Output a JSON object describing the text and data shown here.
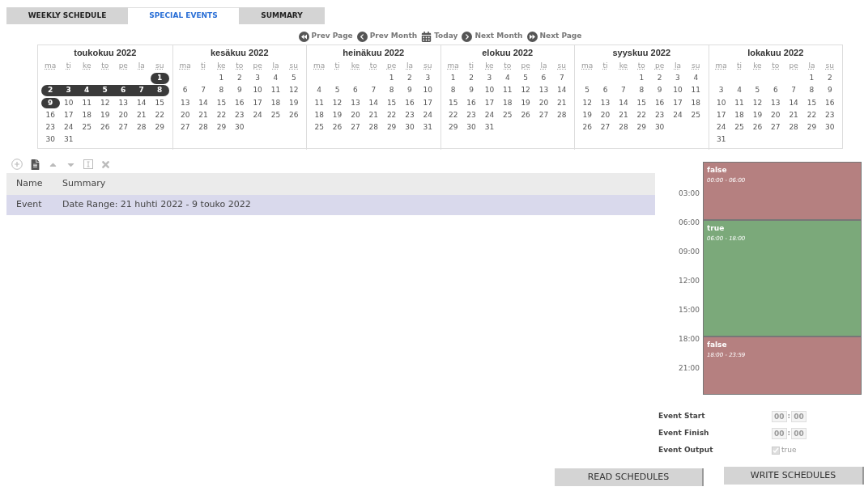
{
  "tabs": [
    {
      "label": "WEEKLY SCHEDULE",
      "selected": false
    },
    {
      "label": "SPECIAL EVENTS",
      "selected": true
    },
    {
      "label": "SUMMARY",
      "selected": false
    }
  ],
  "nav": [
    {
      "kind": "rewind",
      "label": "Prev Page"
    },
    {
      "kind": "back",
      "label": "Prev Month"
    },
    {
      "kind": "calendar",
      "label": "Today"
    },
    {
      "kind": "forward",
      "label": "Next Month"
    },
    {
      "kind": "fastforward",
      "label": "Next Page"
    }
  ],
  "months": [
    {
      "title": "toukokuu  2022",
      "weekdays": [
        "ma",
        "ti",
        "ke",
        "to",
        "pe",
        "la",
        "su"
      ],
      "weeks": [
        {
          "kind": "end",
          "days": [
            {
              "day": "1",
              "selected": true
            }
          ]
        },
        {
          "kind": "full",
          "days": [
            {
              "day": "2",
              "selected": true
            },
            {
              "day": "3",
              "selected": true
            },
            {
              "day": "4",
              "selected": true
            },
            {
              "day": "5",
              "selected": true
            },
            {
              "day": "6",
              "selected": true
            },
            {
              "day": "7",
              "selected": true
            },
            {
              "day": "8",
              "selected": true
            }
          ]
        },
        {
          "kind": "full",
          "days": [
            {
              "day": "9",
              "selected": true
            },
            {
              "day": "10",
              "selected": false
            },
            {
              "day": "11",
              "selected": false
            },
            {
              "day": "12",
              "selected": false
            },
            {
              "day": "13",
              "selected": false
            },
            {
              "day": "14",
              "selected": false
            },
            {
              "day": "15",
              "selected": false
            }
          ]
        },
        {
          "kind": "full",
          "days": [
            {
              "day": "16",
              "selected": false
            },
            {
              "day": "17",
              "selected": false
            },
            {
              "day": "18",
              "selected": false
            },
            {
              "day": "19",
              "selected": false
            },
            {
              "day": "20",
              "selected": false
            },
            {
              "day": "21",
              "selected": false
            },
            {
              "day": "22",
              "selected": false
            }
          ]
        },
        {
          "kind": "full",
          "days": [
            {
              "day": "23",
              "selected": false
            },
            {
              "day": "24",
              "selected": false
            },
            {
              "day": "25",
              "selected": false
            },
            {
              "day": "26",
              "selected": false
            },
            {
              "day": "27",
              "selected": false
            },
            {
              "day": "28",
              "selected": false
            },
            {
              "day": "29",
              "selected": false
            }
          ]
        },
        {
          "kind": "start",
          "days": [
            {
              "day": "30",
              "selected": false
            },
            {
              "day": "31",
              "selected": false
            }
          ]
        }
      ]
    },
    {
      "title": "kesäkuu  2022",
      "weekdays": [
        "ma",
        "ti",
        "ke",
        "to",
        "pe",
        "la",
        "su"
      ],
      "weeks": [
        {
          "kind": "end",
          "days": [
            "1",
            "2",
            "3",
            "4",
            "5"
          ]
        },
        {
          "kind": "full",
          "days": [
            "6",
            "7",
            "8",
            "9",
            "10",
            "11",
            "12"
          ]
        },
        {
          "kind": "full",
          "days": [
            "13",
            "14",
            "15",
            "16",
            "17",
            "18",
            "19"
          ]
        },
        {
          "kind": "full",
          "days": [
            "20",
            "21",
            "22",
            "23",
            "24",
            "25",
            "26"
          ]
        },
        {
          "kind": "start",
          "days": [
            "27",
            "28",
            "29",
            "30"
          ]
        }
      ]
    },
    {
      "title": "heinäkuu  2022",
      "weekdays": [
        "ma",
        "ti",
        "ke",
        "to",
        "pe",
        "la",
        "su"
      ],
      "weeks": [
        {
          "kind": "end",
          "days": [
            "1",
            "2",
            "3"
          ]
        },
        {
          "kind": "full",
          "days": [
            "4",
            "5",
            "6",
            "7",
            "8",
            "9",
            "10"
          ]
        },
        {
          "kind": "full",
          "days": [
            "11",
            "12",
            "13",
            "14",
            "15",
            "16",
            "17"
          ]
        },
        {
          "kind": "full",
          "days": [
            "18",
            "19",
            "20",
            "21",
            "22",
            "23",
            "24"
          ]
        },
        {
          "kind": "full",
          "days": [
            "25",
            "26",
            "27",
            "28",
            "29",
            "30",
            "31"
          ]
        }
      ]
    },
    {
      "title": "elokuu  2022",
      "weekdays": [
        "ma",
        "ti",
        "ke",
        "to",
        "pe",
        "la",
        "su"
      ],
      "weeks": [
        {
          "kind": "full",
          "days": [
            "1",
            "2",
            "3",
            "4",
            "5",
            "6",
            "7"
          ]
        },
        {
          "kind": "full",
          "days": [
            "8",
            "9",
            "10",
            "11",
            "12",
            "13",
            "14"
          ]
        },
        {
          "kind": "full",
          "days": [
            "15",
            "16",
            "17",
            "18",
            "19",
            "20",
            "21"
          ]
        },
        {
          "kind": "full",
          "days": [
            "22",
            "23",
            "24",
            "25",
            "26",
            "27",
            "28"
          ]
        },
        {
          "kind": "start",
          "days": [
            "29",
            "30",
            "31"
          ]
        }
      ]
    },
    {
      "title": "syyskuu  2022",
      "weekdays": [
        "ma",
        "ti",
        "ke",
        "to",
        "pe",
        "la",
        "su"
      ],
      "weeks": [
        {
          "kind": "end",
          "days": [
            "1",
            "2",
            "3",
            "4"
          ]
        },
        {
          "kind": "full",
          "days": [
            "5",
            "6",
            "7",
            "8",
            "9",
            "10",
            "11"
          ]
        },
        {
          "kind": "full",
          "days": [
            "12",
            "13",
            "14",
            "15",
            "16",
            "17",
            "18"
          ]
        },
        {
          "kind": "full",
          "days": [
            "19",
            "20",
            "21",
            "22",
            "23",
            "24",
            "25"
          ]
        },
        {
          "kind": "start",
          "days": [
            "26",
            "27",
            "28",
            "29",
            "30"
          ]
        }
      ]
    },
    {
      "title": "lokakuu  2022",
      "weekdays": [
        "ma",
        "ti",
        "ke",
        "to",
        "pe",
        "la",
        "su"
      ],
      "weeks": [
        {
          "kind": "end",
          "days": [
            "1",
            "2"
          ]
        },
        {
          "kind": "full",
          "days": [
            "3",
            "4",
            "5",
            "6",
            "7",
            "8",
            "9"
          ]
        },
        {
          "kind": "full",
          "days": [
            "10",
            "11",
            "12",
            "13",
            "14",
            "15",
            "16"
          ]
        },
        {
          "kind": "full",
          "days": [
            "17",
            "18",
            "19",
            "20",
            "21",
            "22",
            "23"
          ]
        },
        {
          "kind": "full",
          "days": [
            "24",
            "25",
            "26",
            "27",
            "28",
            "29",
            "30"
          ]
        },
        {
          "kind": "start",
          "days": [
            "31"
          ]
        }
      ]
    }
  ],
  "toolbar": [
    {
      "kind": "add",
      "disabled": true
    },
    {
      "kind": "document",
      "disabled": false
    },
    {
      "kind": "up",
      "disabled": true
    },
    {
      "kind": "down",
      "disabled": true
    },
    {
      "kind": "rename",
      "disabled": true
    },
    {
      "kind": "delete",
      "disabled": true
    }
  ],
  "table": {
    "columns": [
      "Name",
      "Summary"
    ],
    "rows": [
      {
        "cells": [
          "Event",
          "Date Range: 21 huhti 2022 - 9 touko 2022"
        ],
        "selected": true
      }
    ]
  },
  "timeline": {
    "hours": [
      "03:00",
      "06:00",
      "09:00",
      "12:00",
      "15:00",
      "18:00",
      "21:00"
    ],
    "blocks": [
      {
        "value": "false",
        "range": "00:00 - 06:00",
        "color": "#b58080"
      },
      {
        "value": "true",
        "range": "06:00 - 18:00",
        "color": "#7ba97a"
      },
      {
        "value": "false",
        "range": "18:00 - 23:59",
        "color": "#b58080"
      }
    ]
  },
  "event": {
    "start": {
      "label": "Event Start",
      "hours": "00",
      "minutes": "00",
      "separator": ":"
    },
    "finish": {
      "label": "Event Finish",
      "hours": "00",
      "minutes": "00",
      "separator": ":"
    },
    "output": {
      "label": "Event Output",
      "checked": true,
      "text": "true"
    }
  },
  "buttons": [
    "READ SCHEDULES",
    "WRITE SCHEDULES"
  ]
}
